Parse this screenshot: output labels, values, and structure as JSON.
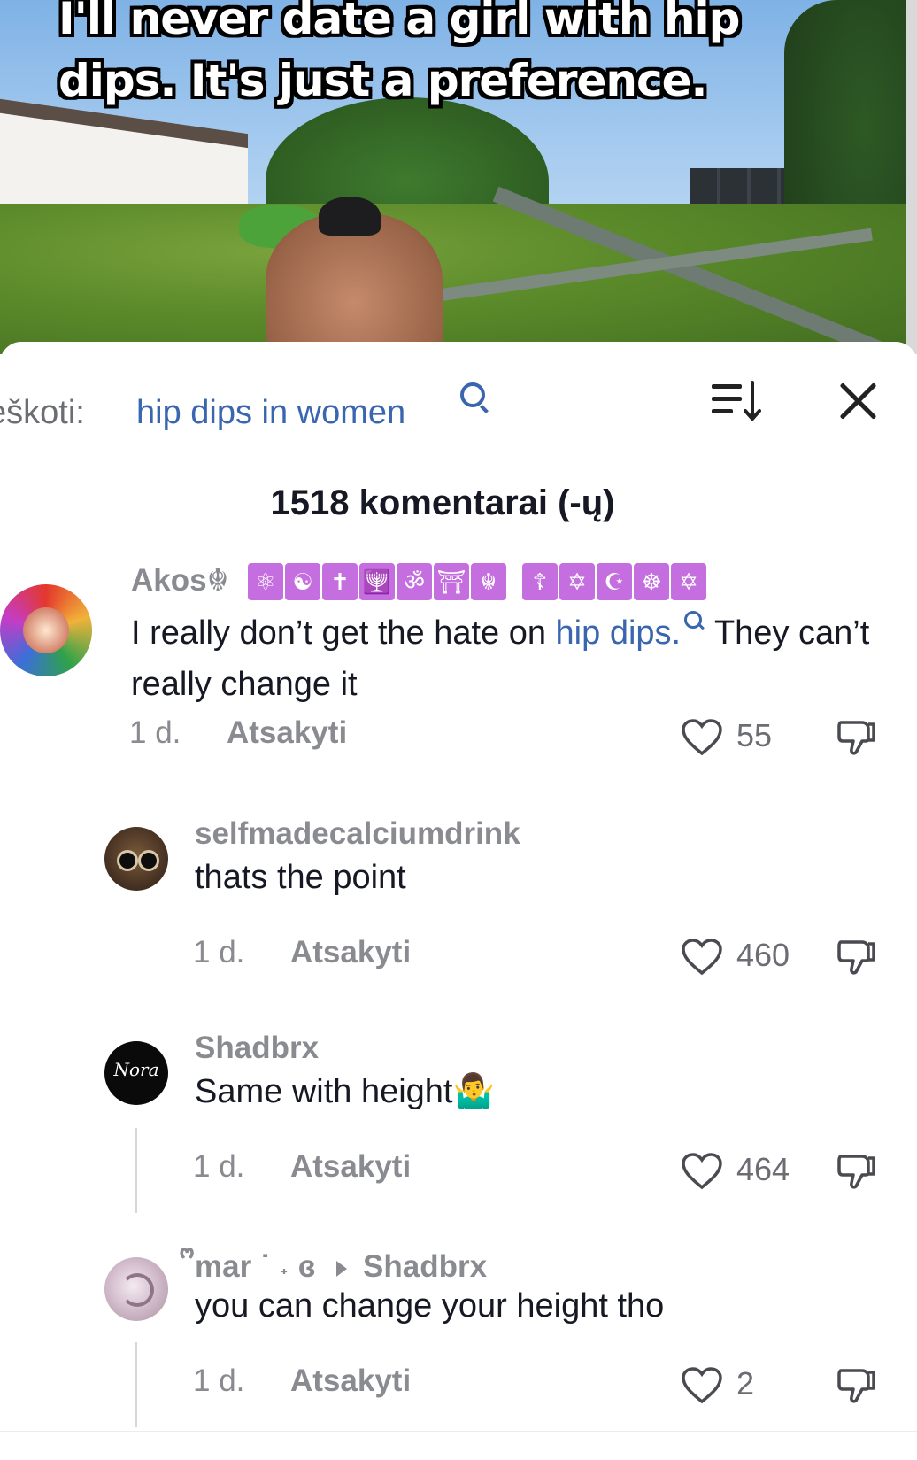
{
  "video": {
    "caption_line1": "I'll never date a girl with hip",
    "caption_line2": "dips. It's just a preference."
  },
  "sheet": {
    "search_prefix": "eškoti:",
    "search_term": "hip dips in women",
    "comment_count": "1518 komentarai (-ų)",
    "icons": [
      "sort-icon",
      "close-icon",
      "search-icon"
    ]
  },
  "comments": [
    {
      "username": "Akos☬",
      "username_badges": [
        "⚛",
        "☯",
        "✝",
        "🕎",
        "ॐ",
        "⛩",
        "☬",
        "☦",
        "✡",
        "☪",
        "☸",
        "✡"
      ],
      "text_before": "I really don’t get the hate on ",
      "text_link": "hip dips.",
      "text_after": " They can’t really change it",
      "time": "1 d.",
      "reply_label": "Atsakyti",
      "likes": "55"
    },
    {
      "username": "selfmadecalciumdrink",
      "text": "thats the point",
      "time": "1 d.",
      "reply_label": "Atsakyti",
      "likes": "460"
    },
    {
      "username": "Shadbrx",
      "text": "Same with height🤷‍♂️",
      "time": "1 d.",
      "reply_label": "Atsakyti",
      "likes": "464",
      "avatar_text": "Nora"
    },
    {
      "username": "ᩚmar ˙ ˖ ɞ",
      "reply_to": "Shadbrx",
      "text": "you can change your height tho",
      "time": "1 d.",
      "reply_label": "Atsakyti",
      "likes": "2"
    }
  ],
  "colors": {
    "link": "#3a66b0",
    "muted": "#8a8b91",
    "text": "#161823",
    "badge": "#c46ee0"
  }
}
